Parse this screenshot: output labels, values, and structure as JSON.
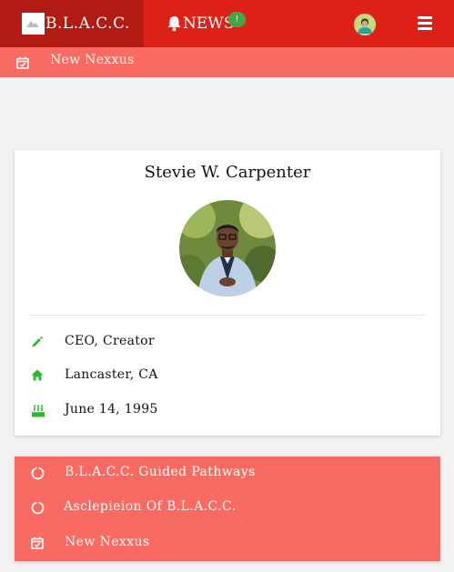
{
  "header": {
    "brand": "B.L.A.C.C.",
    "news_label": "NEWS",
    "news_badge": "!"
  },
  "subnav": {
    "label": "New Nexxus"
  },
  "profile": {
    "name": "Stevie W. Carpenter",
    "details": [
      {
        "icon": "pencil-icon",
        "text": "CEO, Creator"
      },
      {
        "icon": "home-icon",
        "text": "Lancaster, CA"
      },
      {
        "icon": "birthday-cake-icon",
        "text": "June 14, 1995"
      }
    ]
  },
  "links": [
    {
      "icon": "circle-notch-icon",
      "text": "B.L.A.C.C. Guided Pathways"
    },
    {
      "icon": "circle-notch-icon",
      "text": "Asclepieion Of B.L.A.C.C."
    },
    {
      "icon": "calendar-check-icon",
      "text": "New Nexxus"
    }
  ],
  "colors": {
    "header_bg": "#dd2119",
    "brand_bg": "#b01b13",
    "accent_bar": "#f96b62",
    "icon_green": "#2eb82e",
    "badge_green": "#3da84a"
  }
}
